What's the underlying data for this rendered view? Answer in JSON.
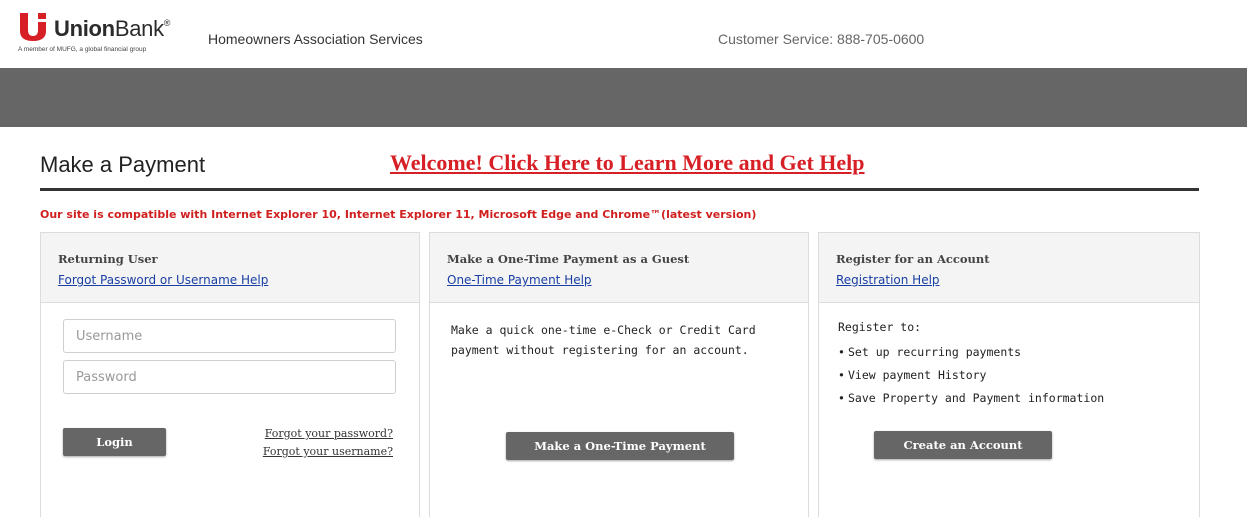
{
  "header": {
    "logo_prefix": "Union",
    "logo_suffix": "Bank",
    "logo_mark": "®",
    "logo_tagline": "A member of MUFG, a global financial group",
    "service_name": "Homeowners Association Services",
    "customer_service": "Customer Service: 888-705-0600"
  },
  "main": {
    "title": "Make a Payment",
    "welcome_link": "Welcome! Click Here to Learn More and Get Help",
    "compat_notice": "Our site is compatible with Internet Explorer 10, Internet Explorer 11, Microsoft Edge and Chrome™(latest version)"
  },
  "returning": {
    "title": "Returning User",
    "help_link": "Forgot Password or Username Help",
    "username_placeholder": "Username",
    "username_value": "",
    "password_placeholder": "Password",
    "password_value": "",
    "login_label": "Login",
    "forgot_password": "Forgot your password?",
    "forgot_username": "Forgot your username?"
  },
  "guest": {
    "title": "Make a One-Time Payment as a Guest",
    "help_link": "One-Time Payment Help",
    "description": "Make a quick one-time e-Check or Credit Card payment without registering for an account.",
    "button_label": "Make a One-Time Payment"
  },
  "register": {
    "title": "Register for an Account",
    "help_link": "Registration Help",
    "intro": "Register to:",
    "items": [
      "Set up recurring payments",
      "View payment History",
      "Save Property and Payment information"
    ],
    "button_label": "Create an Account"
  },
  "colors": {
    "brand_red": "#d71f26",
    "band_gray": "#666666",
    "link_blue": "#1a3fa3"
  },
  "icons": {
    "logo": "unionbank-u-logo-icon"
  }
}
